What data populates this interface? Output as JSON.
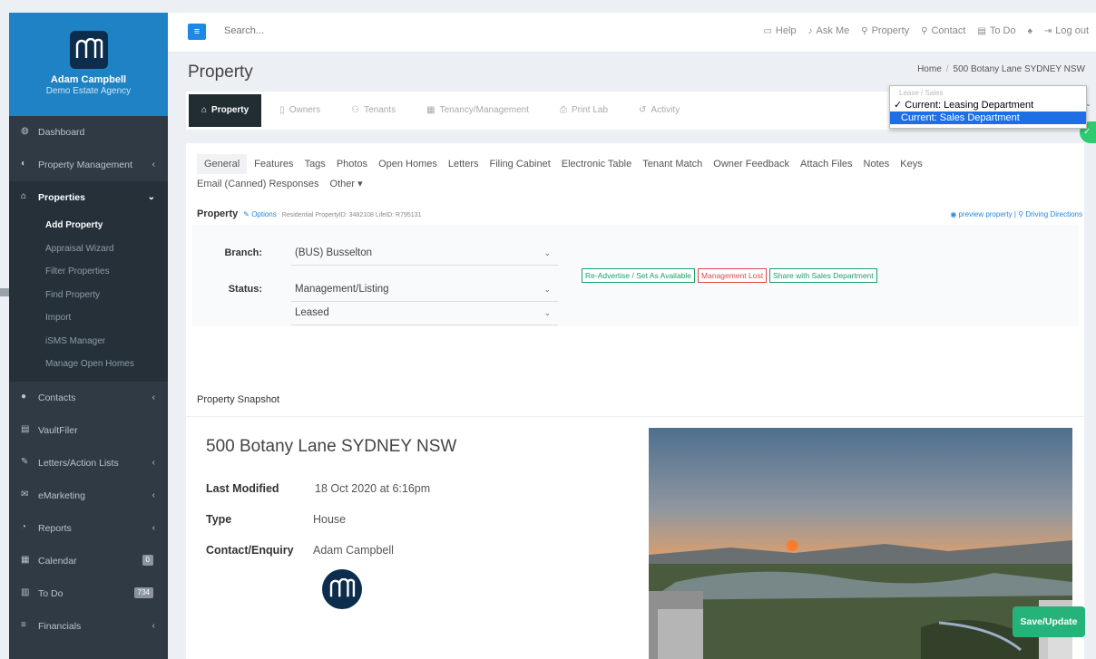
{
  "sidebar": {
    "user_name": "Adam Campbell",
    "agency": "Demo Estate Agency",
    "items": [
      {
        "label": "Dashboard",
        "icon": "dashboard-icon"
      },
      {
        "label": "Property Management",
        "icon": "property-management-icon"
      },
      {
        "label": "Properties",
        "icon": "home-icon"
      },
      {
        "label": "Contacts",
        "icon": "user-icon"
      },
      {
        "label": "VaultFiler",
        "icon": "vault-icon"
      },
      {
        "label": "Letters/Action Lists",
        "icon": "edit-icon"
      },
      {
        "label": "eMarketing",
        "icon": "envelope-icon"
      },
      {
        "label": "Reports",
        "icon": "reports-icon"
      },
      {
        "label": "Calendar",
        "icon": "calendar-icon",
        "badge": "0"
      },
      {
        "label": "To Do",
        "icon": "todo-icon",
        "badge": "734"
      },
      {
        "label": "Financials",
        "icon": "financials-icon"
      }
    ],
    "properties_submenu": [
      "Add Property",
      "Appraisal Wizard",
      "Filter Properties",
      "Find Property",
      "Import",
      "iSMS Manager",
      "Manage Open Homes"
    ]
  },
  "topbar": {
    "search_placeholder": "Search...",
    "nav": [
      "Help",
      "Ask Me",
      "Property",
      "Contact",
      "To Do",
      "Log out"
    ]
  },
  "page": {
    "title": "Property",
    "breadcrumb": [
      "Home",
      "500 Botany Lane SYDNEY NSW"
    ]
  },
  "subtabs": [
    "Property",
    "Owners",
    "Tenants",
    "Tenancy/Management",
    "Print Lab",
    "Activity"
  ],
  "department_dropdown": {
    "header": "Lease / Sales",
    "options": [
      "✓ Current: Leasing Department",
      "Current: Sales Department"
    ]
  },
  "tabs": [
    "General",
    "Features",
    "Tags",
    "Photos",
    "Open Homes",
    "Letters",
    "Filing Cabinet",
    "Electronic Table",
    "Tenant Match",
    "Owner Feedback",
    "Attach Files",
    "Notes",
    "Keys"
  ],
  "tabs_row2": [
    "Email (Canned) Responses",
    "Other ▾"
  ],
  "property_header": {
    "label": "Property",
    "options": "Options",
    "meta": "Residential PropertyID: 3482108 LifeID: R795131",
    "preview": "preview property",
    "directions": "Driving Directions"
  },
  "form": {
    "branch_label": "Branch:",
    "branch_value": "(BUS) Busselton",
    "status_label": "Status:",
    "status_value": "Management/Listing",
    "substatus_value": "Leased",
    "buttons": [
      "Re-Advertise / Set As Available",
      "Management Lost",
      "Share with Sales Department"
    ]
  },
  "snapshot": {
    "title": "Property Snapshot",
    "address": "500 Botany Lane SYDNEY NSW",
    "last_modified_label": "Last Modified",
    "last_modified": "18 Oct 2020 at 6:16pm",
    "type_label": "Type",
    "type": "House",
    "contact_label": "Contact/Enquiry",
    "contact": "Adam Campbell"
  },
  "save_label": "Save/Update",
  "colors": {
    "sidebar": "#2f3a45",
    "brand_blue": "#1e82c4",
    "save_green": "#26b37a"
  }
}
